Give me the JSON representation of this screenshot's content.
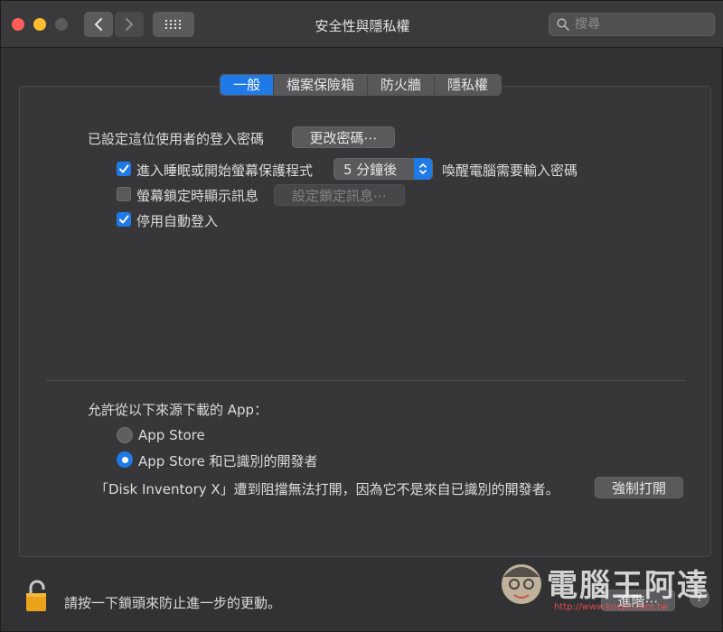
{
  "window": {
    "title": "安全性與隱私權"
  },
  "search": {
    "placeholder": "搜尋"
  },
  "tabs": [
    {
      "label": "一般",
      "active": true
    },
    {
      "label": "檔案保險箱",
      "active": false
    },
    {
      "label": "防火牆",
      "active": false
    },
    {
      "label": "隱私權",
      "active": false
    }
  ],
  "general": {
    "password_label": "已設定這位使用者的登入密碼",
    "change_password_button": "更改密碼⋯",
    "require_password": {
      "label": "進入睡眠或開始螢幕保護程式",
      "checked": true,
      "delay_value": "5 分鐘後",
      "suffix": "喚醒電腦需要輸入密碼"
    },
    "show_message": {
      "label": "螢幕鎖定時顯示訊息",
      "checked": false,
      "button": "設定鎖定訊息⋯"
    },
    "disable_autologin": {
      "label": "停用自動登入",
      "checked": true
    }
  },
  "downloads": {
    "heading": "允許從以下來源下載的 App：",
    "options": [
      {
        "label": "App Store",
        "selected": false
      },
      {
        "label": "App Store 和已識別的開發者",
        "selected": true
      }
    ],
    "blocked_message": "「Disk Inventory X」遭到阻擋無法打開，因為它不是來自已識別的開發者。",
    "open_anyway_button": "強制打開"
  },
  "footer": {
    "lock_text": "請按一下鎖頭來防止進一步的更動。",
    "advanced_button": "進階⋯",
    "help": "?"
  },
  "watermark": {
    "text": "電腦王阿達",
    "url": "http://www.kocpc.com.tw"
  },
  "colors": {
    "accent": "#1f7ae8",
    "background": "#323234",
    "panel": "#37373a"
  }
}
